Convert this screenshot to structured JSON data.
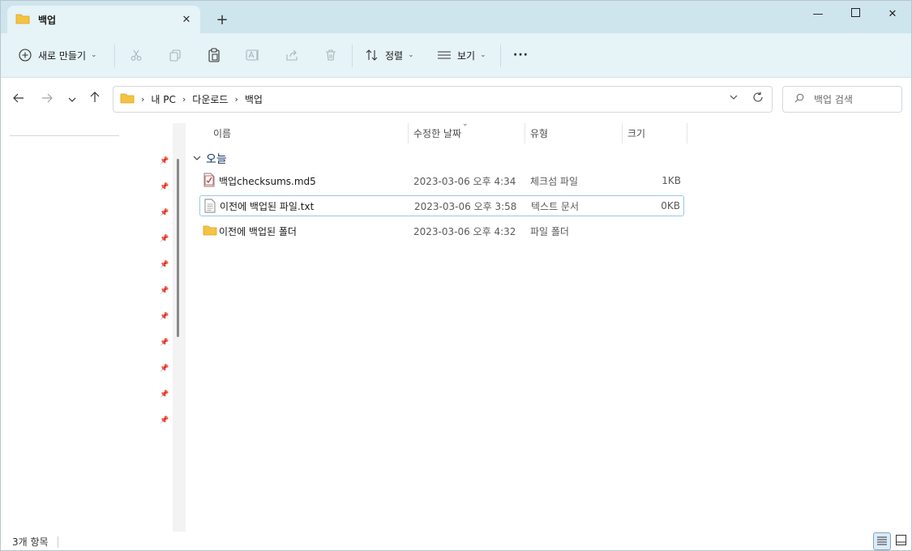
{
  "window": {
    "tab_title": "백업",
    "new_tab_symbol": "+",
    "close_tab_symbol": "✕",
    "minimize_symbol": "—",
    "close_symbol": "✕"
  },
  "toolbar": {
    "new_label": "새로 만들기",
    "sort_label": "정렬",
    "view_label": "보기",
    "more_symbol": "···"
  },
  "address": {
    "crumbs": [
      "내 PC",
      "다운로드",
      "백업"
    ],
    "search_placeholder": "백업 검색"
  },
  "columns": {
    "name": "이름",
    "date": "수정한 날짜",
    "type": "유형",
    "size": "크기"
  },
  "group": {
    "label": "오늘"
  },
  "files": [
    {
      "name": "백업checksums.md5",
      "date": "2023-03-06 오후 4:34",
      "type": "체크섬 파일",
      "size": "1KB",
      "icon": "checksum-file-icon"
    },
    {
      "name": "이전에 백업된 파일.txt",
      "date": "2023-03-06 오후 3:58",
      "type": "텍스트 문서",
      "size": "0KB",
      "icon": "text-file-icon"
    },
    {
      "name": "이전에 백업된 폴더",
      "date": "2023-03-06 오후 4:32",
      "type": "파일 폴더",
      "size": "",
      "icon": "folder-icon"
    }
  ],
  "status": {
    "item_count": "3개 항목"
  },
  "colors": {
    "titlebar": "#cfe5ee",
    "toolbar": "#e6f3f7",
    "folder": "#f5c342",
    "selection_border": "#99c9e6"
  }
}
